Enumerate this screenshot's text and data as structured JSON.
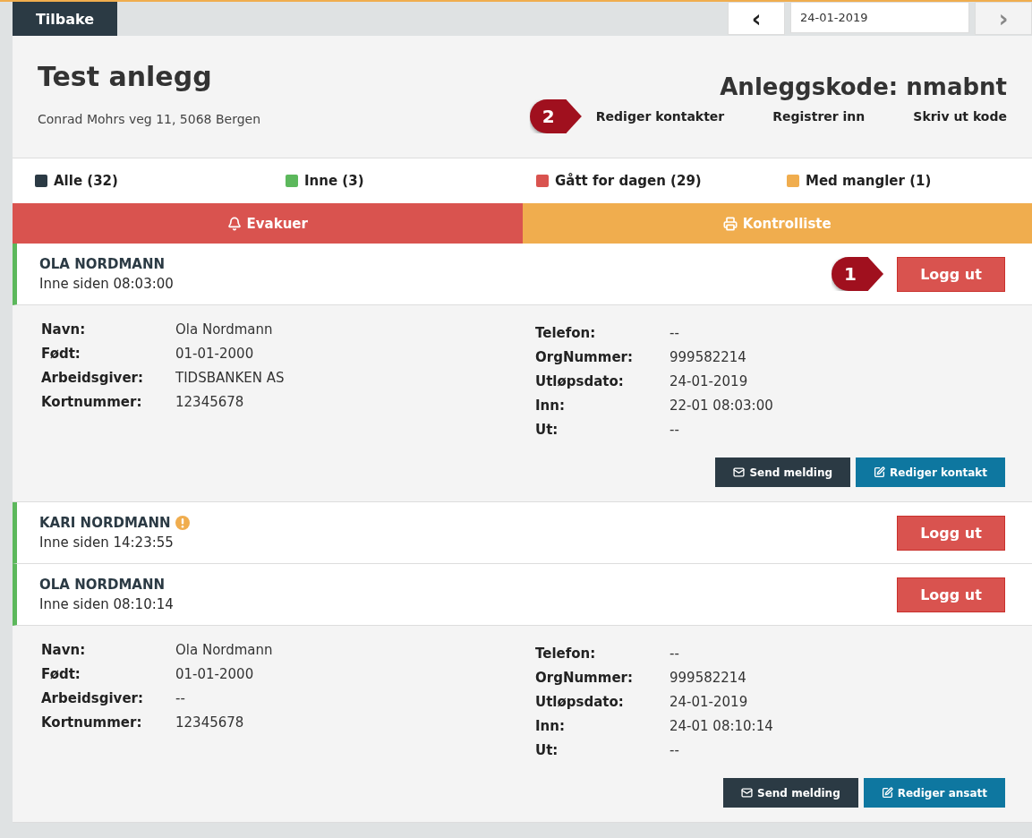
{
  "topbar": {
    "back": "Tilbake",
    "prev": "‹",
    "date": "24-01-2019",
    "next": "›"
  },
  "site": {
    "title": "Test anlegg",
    "address": "Conrad Mohrs veg 11, 5068 Bergen",
    "code_label": "Anleggskode:",
    "code": "nmabnt"
  },
  "header_links": [
    {
      "label": "Rediger kontakter",
      "callout": "2"
    },
    {
      "label": "Registrer inn"
    },
    {
      "label": "Skriv ut kode"
    }
  ],
  "filters": [
    {
      "label": "Alle (32)",
      "color": "#2b3a44"
    },
    {
      "label": "Inne (3)",
      "color": "#5cb85c"
    },
    {
      "label": "Gått for dagen (29)",
      "color": "#d9534f"
    },
    {
      "label": "Med mangler (1)",
      "color": "#f0ad4e"
    }
  ],
  "actions": [
    {
      "kind": "alarm",
      "label": "Evakuer"
    },
    {
      "kind": "print",
      "label": "Kontrolliste"
    }
  ],
  "people": [
    {
      "name": "OLA NORDMANN",
      "since": "Inne siden 08:03:00",
      "warning": false,
      "expanded": true,
      "logout": "Logg ut",
      "callout": "1",
      "left": [
        {
          "label": "Navn:",
          "value": "Ola Nordmann"
        },
        {
          "label": "Født:",
          "value": "01-01-2000"
        },
        {
          "label": "Arbeidsgiver:",
          "value": "TIDSBANKEN AS"
        },
        {
          "label": "Kortnummer:",
          "value": "12345678"
        }
      ],
      "right": [
        {
          "label": "Telefon:",
          "value": "--"
        },
        {
          "label": "OrgNummer:",
          "value": "999582214"
        },
        {
          "label": "Utløpsdato:",
          "value": "24-01-2019"
        },
        {
          "label": "Inn:",
          "value": "22-01 08:03:00"
        },
        {
          "label": "Ut:",
          "value": "--"
        }
      ],
      "buttons": [
        {
          "kind": "message",
          "label": "Send melding"
        },
        {
          "kind": "edit",
          "label": "Rediger kontakt"
        }
      ]
    },
    {
      "name": "KARI NORDMANN",
      "since": "Inne siden 14:23:55",
      "warning": true,
      "expanded": false,
      "logout": "Logg ut"
    },
    {
      "name": "OLA NORDMANN",
      "since": "Inne siden 08:10:14",
      "warning": false,
      "expanded": true,
      "logout": "Logg ut",
      "left": [
        {
          "label": "Navn:",
          "value": "Ola Nordmann"
        },
        {
          "label": "Født:",
          "value": "01-01-2000"
        },
        {
          "label": "Arbeidsgiver:",
          "value": "--"
        },
        {
          "label": "Kortnummer:",
          "value": "12345678"
        }
      ],
      "right": [
        {
          "label": "Telefon:",
          "value": "--"
        },
        {
          "label": "OrgNummer:",
          "value": "999582214"
        },
        {
          "label": "Utløpsdato:",
          "value": "24-01-2019"
        },
        {
          "label": "Inn:",
          "value": "24-01 08:10:14"
        },
        {
          "label": "Ut:",
          "value": "--"
        }
      ],
      "buttons": [
        {
          "kind": "message",
          "label": "Send melding"
        },
        {
          "kind": "edit",
          "label": "Rediger ansatt"
        }
      ]
    }
  ]
}
